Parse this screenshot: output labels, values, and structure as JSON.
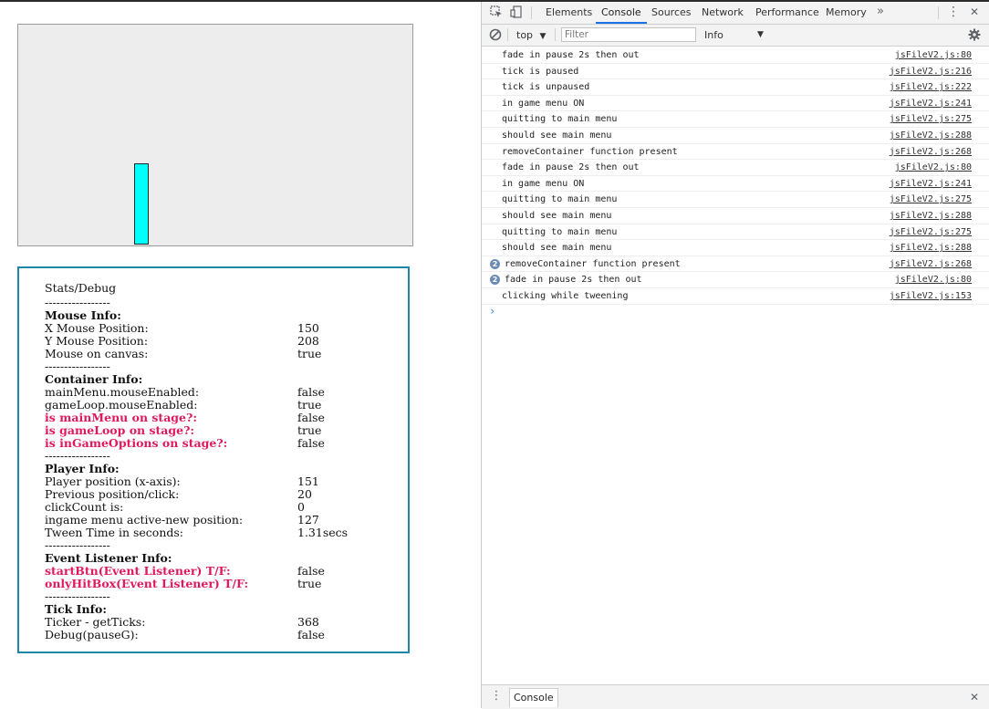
{
  "stats": {
    "title": "Stats/Debug",
    "separator": "-----------------",
    "rows": [
      {
        "type": "head",
        "label": "Mouse Info:"
      },
      {
        "type": "kv",
        "label": "X Mouse Position:",
        "value": "150"
      },
      {
        "type": "kv",
        "label": "Y Mouse Position:",
        "value": "208"
      },
      {
        "type": "kv",
        "label": "Mouse on canvas:",
        "value": "true"
      },
      {
        "type": "sep"
      },
      {
        "type": "head",
        "label": "Container Info:"
      },
      {
        "type": "kv",
        "label": "mainMenu.mouseEnabled:",
        "value": "false"
      },
      {
        "type": "kv",
        "label": "gameLoop.mouseEnabled:",
        "value": "true"
      },
      {
        "type": "red",
        "label": "is mainMenu on stage?:",
        "value": "false"
      },
      {
        "type": "red",
        "label": "is gameLoop on stage?:",
        "value": "true"
      },
      {
        "type": "red",
        "label": "is inGameOptions on stage?:",
        "value": "false"
      },
      {
        "type": "sep"
      },
      {
        "type": "head",
        "label": "Player Info:"
      },
      {
        "type": "kv",
        "label": "Player position (x-axis):",
        "value": "151"
      },
      {
        "type": "kv",
        "label": "Previous position/click:",
        "value": "20"
      },
      {
        "type": "kv",
        "label": "clickCount is:",
        "value": "0"
      },
      {
        "type": "kv",
        "label": "ingame menu active-new position:",
        "value": "127"
      },
      {
        "type": "kv",
        "label": "Tween Time in seconds:",
        "value": "1.31secs"
      },
      {
        "type": "sep"
      },
      {
        "type": "head",
        "label": "Event Listener Info:"
      },
      {
        "type": "red",
        "label": "startBtn(Event Listener) T/F:",
        "value": "false"
      },
      {
        "type": "red",
        "label": "onlyHitBox(Event Listener) T/F:",
        "value": "true"
      },
      {
        "type": "sep"
      },
      {
        "type": "head",
        "label": "Tick Info:"
      },
      {
        "type": "kv",
        "label": "Ticker - getTicks:",
        "value": "368"
      },
      {
        "type": "kv",
        "label": "Debug(pauseG):",
        "value": "false"
      }
    ]
  },
  "devtools": {
    "tabs": [
      {
        "label": "Elements",
        "active": false
      },
      {
        "label": "Console",
        "active": true
      },
      {
        "label": "Sources",
        "active": false
      },
      {
        "label": "Network",
        "active": false
      },
      {
        "label": "Performance",
        "active": false
      },
      {
        "label": "Memory",
        "active": false
      }
    ],
    "more_tabs_glyph": "»",
    "menu_glyph": "⋮",
    "close_glyph": "✕",
    "context_label": "top",
    "filter_placeholder": "Filter",
    "level_label": "Info",
    "prompt_glyph": "›",
    "drawer_tab_label": "Console",
    "messages": [
      {
        "text": "fade in pause 2s then out",
        "src": "jsFileV2.js:80"
      },
      {
        "text": "tick is paused",
        "src": "jsFileV2.js:216"
      },
      {
        "text": "tick is unpaused",
        "src": "jsFileV2.js:222"
      },
      {
        "text": "in game menu ON",
        "src": "jsFileV2.js:241"
      },
      {
        "text": "quitting to main menu",
        "src": "jsFileV2.js:275"
      },
      {
        "text": "should see main menu",
        "src": "jsFileV2.js:288"
      },
      {
        "text": "removeContainer function present",
        "src": "jsFileV2.js:268"
      },
      {
        "text": "fade in pause 2s then out",
        "src": "jsFileV2.js:80"
      },
      {
        "text": "in game menu ON",
        "src": "jsFileV2.js:241"
      },
      {
        "text": "quitting to main menu",
        "src": "jsFileV2.js:275"
      },
      {
        "text": "should see main menu",
        "src": "jsFileV2.js:288"
      },
      {
        "text": "quitting to main menu",
        "src": "jsFileV2.js:275"
      },
      {
        "text": "should see main menu",
        "src": "jsFileV2.js:288"
      },
      {
        "text": "removeContainer function present",
        "src": "jsFileV2.js:268",
        "count": "2"
      },
      {
        "text": "fade in pause 2s then out",
        "src": "jsFileV2.js:80",
        "count": "2"
      },
      {
        "text": "clicking while tweening",
        "src": "jsFileV2.js:153"
      }
    ]
  },
  "colors": {
    "player_fill": "#00ffff",
    "panel_border": "#1b86a8",
    "highlight_text": "#e0195f",
    "active_tab_underline": "#1a73e8"
  }
}
